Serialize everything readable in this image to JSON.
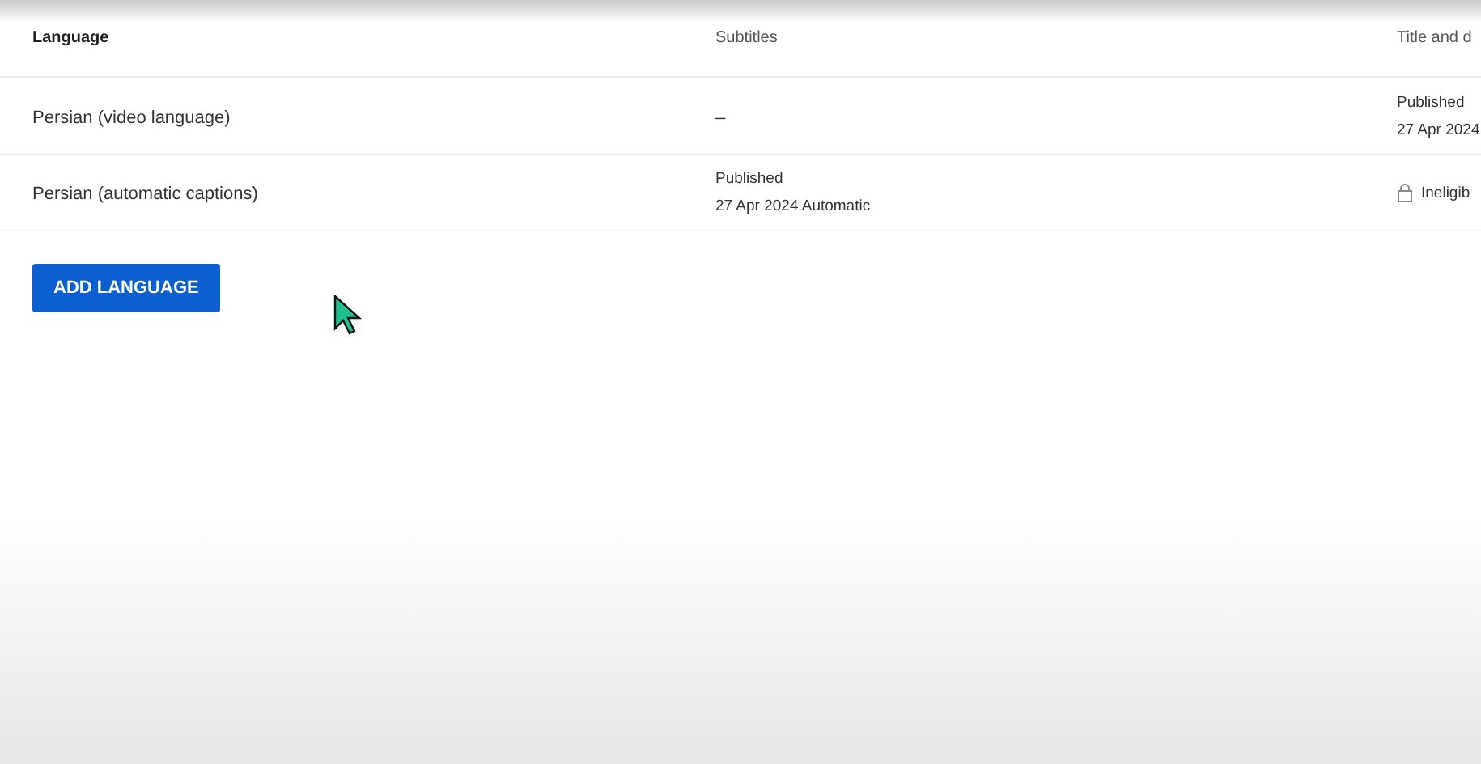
{
  "table": {
    "columns": [
      "Language",
      "Subtitles",
      "Title and d"
    ],
    "rows": [
      {
        "cells": [
          {
            "kind": "text",
            "text": "Persian (video language)"
          },
          {
            "kind": "text",
            "text": "–"
          },
          {
            "kind": "status",
            "text": "Published",
            "detail": "27 Apr 2024"
          }
        ]
      },
      {
        "cells": [
          {
            "kind": "text",
            "text": "Persian (automatic captions)"
          },
          {
            "kind": "status",
            "text": "Published",
            "detail": "27 Apr 2024 Automatic"
          },
          {
            "kind": "locked",
            "text": "Ineligib"
          }
        ]
      }
    ]
  },
  "add_button": "ADD LANGUAGE"
}
